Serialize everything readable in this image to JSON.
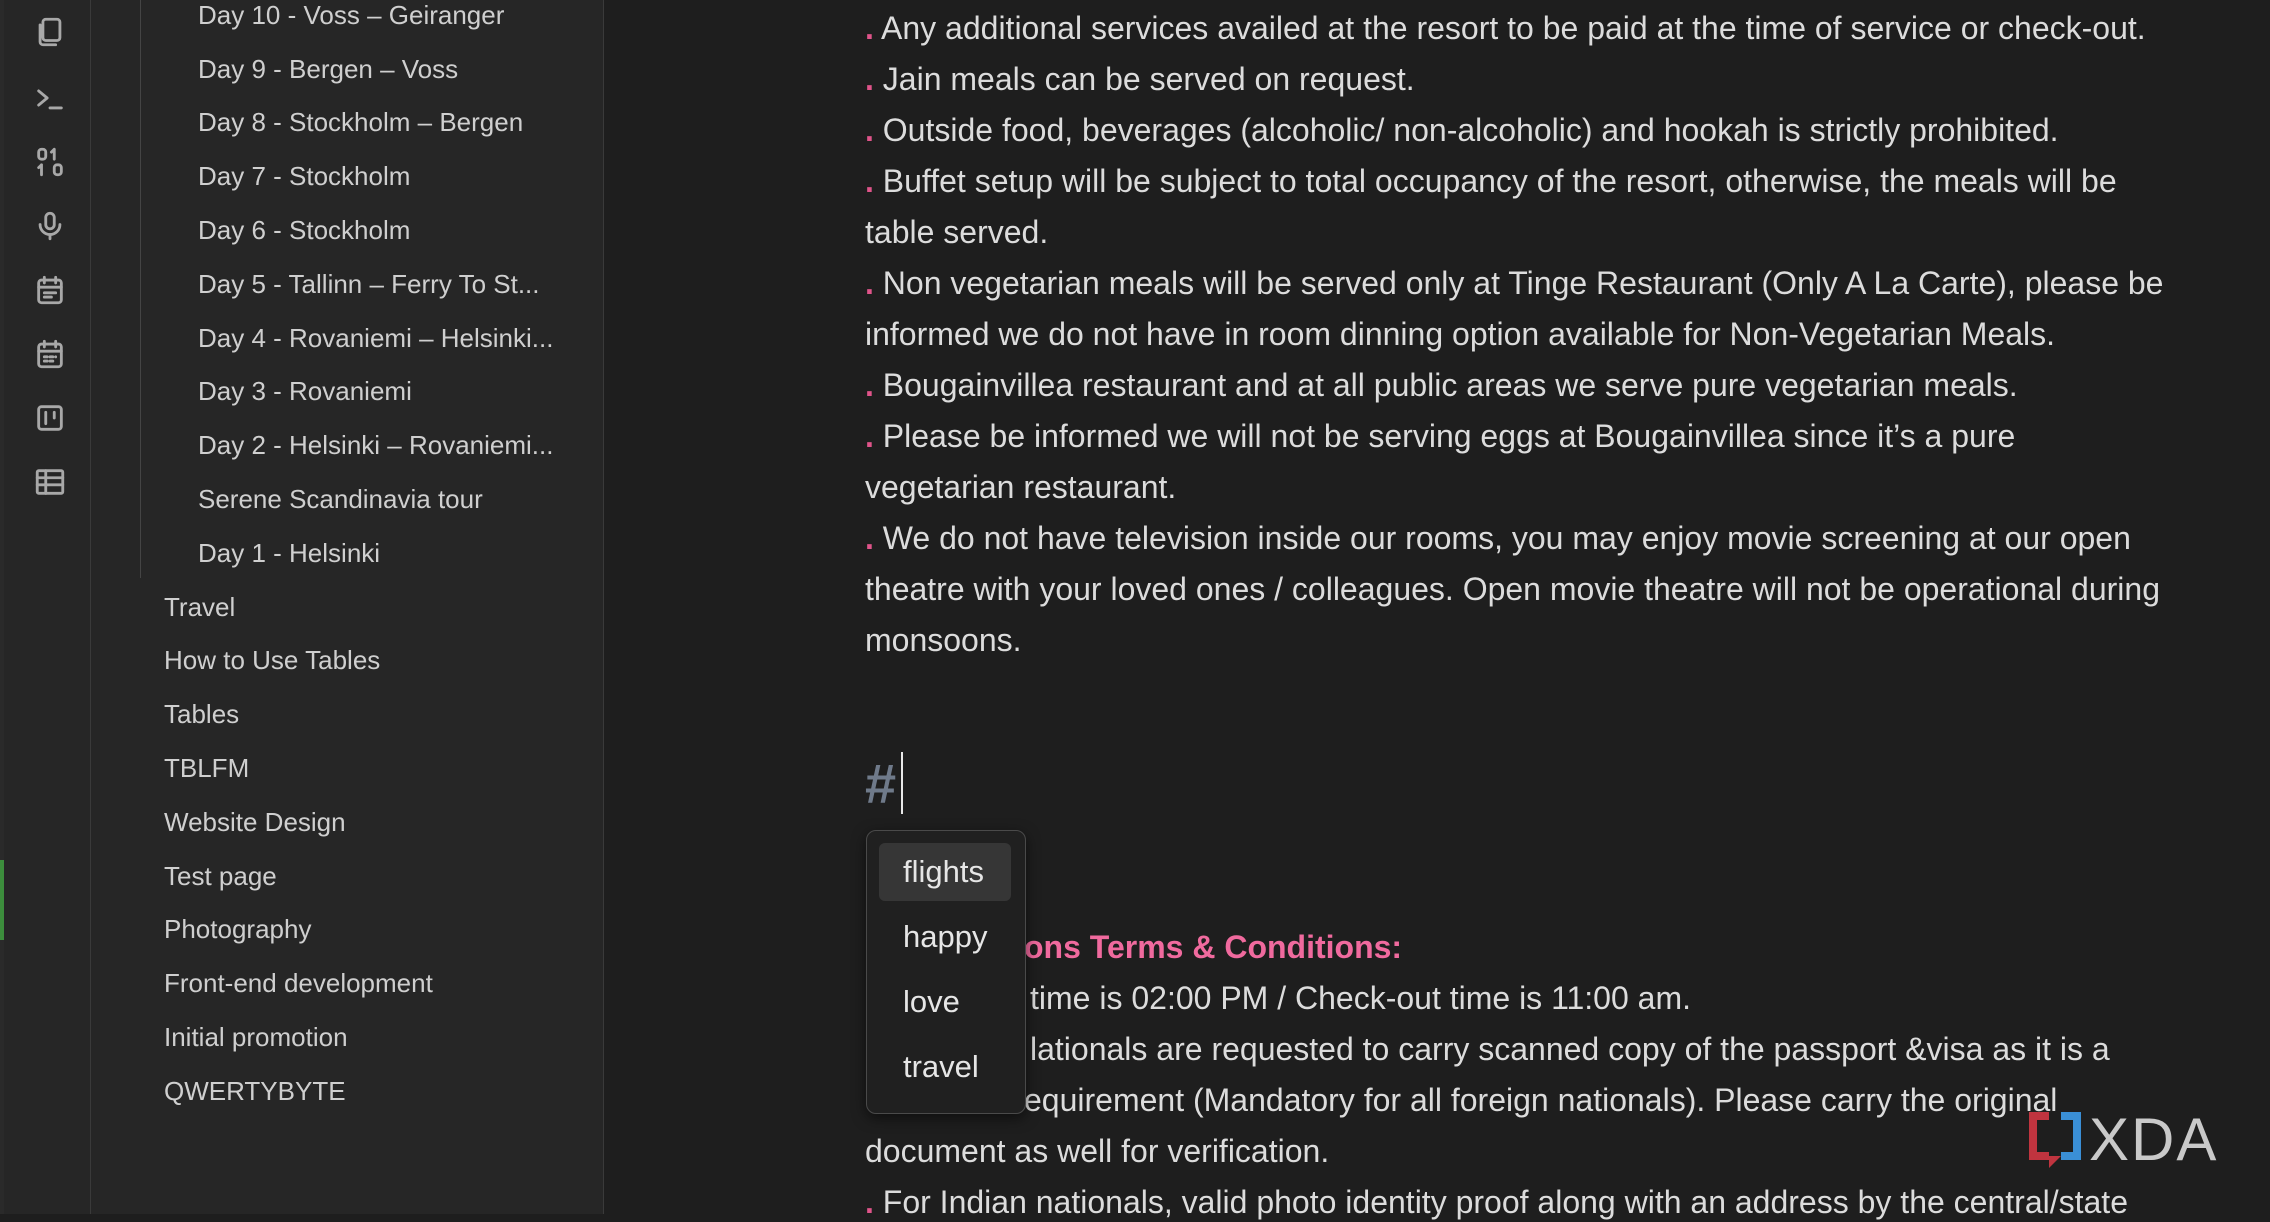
{
  "ribbon": {
    "icons": [
      "files-icon",
      "terminal-icon",
      "binary-icon",
      "microphone-icon",
      "calendar-list-icon",
      "calendar-icon",
      "kanban-icon",
      "table-icon"
    ]
  },
  "sidebar": {
    "children": [
      "Day 10 - Voss – Geiranger",
      "Day 9 - Bergen – Voss",
      "Day 8 - Stockholm – Bergen",
      "Day 7 - Stockholm",
      "Day 6 - Stockholm",
      "Day 5 - Tallinn – Ferry To St...",
      "Day 4 - Rovaniemi – Helsinki...",
      "Day 3 - Rovaniemi",
      "Day 2 - Helsinki – Rovaniemi...",
      "Serene Scandinavia tour",
      "Day 1 - Helsinki"
    ],
    "roots": [
      "Travel",
      "How to Use Tables",
      "Tables",
      "TBLFM",
      "Website Design",
      "Test page",
      "Photography",
      "Front-end development",
      "Initial promotion",
      "QWERTYBYTE"
    ]
  },
  "editor": {
    "bullet": ".",
    "lines": [
      {
        "bullet": true,
        "text": "Any additional services availed at the resort to be paid at the time of service or check-out."
      },
      {
        "bullet": true,
        "text": "Jain meals can be served on request."
      },
      {
        "bullet": true,
        "text": "Outside food, beverages (alcoholic/ non-alcoholic) and hookah is strictly prohibited."
      },
      {
        "bullet": true,
        "text": "Buffet setup will be subject to total occupancy of the resort, otherwise, the meals will be"
      },
      {
        "bullet": false,
        "text": "table served."
      },
      {
        "bullet": true,
        "text": "Non vegetarian meals will be served only at Tinge Restaurant (Only A La Carte), please be"
      },
      {
        "bullet": false,
        "text": "informed we do not have in room dinning option available for Non-Vegetarian Meals."
      },
      {
        "bullet": true,
        "text": "Bougainvillea restaurant and at all public areas we serve pure vegetarian meals."
      },
      {
        "bullet": true,
        "text": "Please be informed we will not be serving eggs at Bougainvillea since it’s a pure"
      },
      {
        "bullet": false,
        "text": "vegetarian restaurant."
      },
      {
        "bullet": true,
        "text": "We do not have television inside our rooms, you may enjoy movie screening at our open"
      },
      {
        "bullet": false,
        "text": "theatre with your loved ones / colleagues. Open movie theatre will not be operational during"
      },
      {
        "bullet": false,
        "text": "monsoons."
      }
    ],
    "heading_hash": "#",
    "lower": {
      "heading_visible": "ons Terms & Conditions:",
      "l1": "time is 02:00 PM / Check-out time is 11:00 am.",
      "l2": "lationals are requested to carry scanned copy of the passport &visa as it is a",
      "l3": "equirement (Mandatory for all foreign nationals). Please carry the original",
      "l4": "document as well for verification.",
      "l5": "For Indian nationals, valid photo identity proof along with an address by the central/state"
    }
  },
  "suggest": {
    "items": [
      "flights",
      "happy",
      "love",
      "travel"
    ],
    "selected": 0
  },
  "watermark": {
    "text": "XDA"
  },
  "colors": {
    "bullet": "#e0548a",
    "heading_pink": "#f06a9e",
    "background": "#1e1e1e",
    "sidebar": "#262626"
  }
}
